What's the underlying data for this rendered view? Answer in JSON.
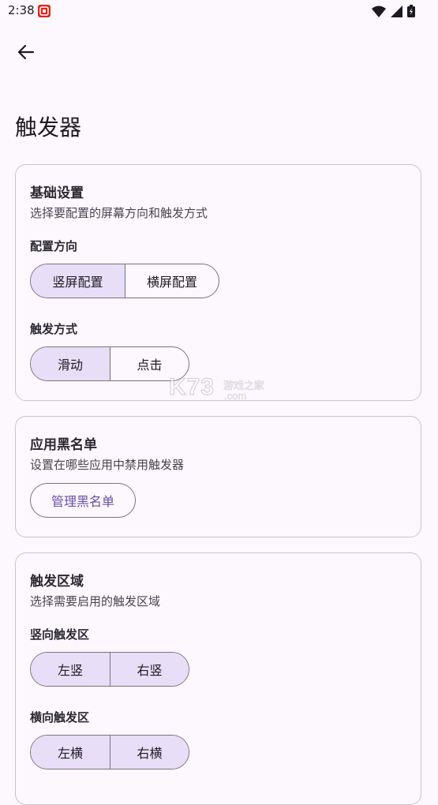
{
  "status_bar": {
    "time": "2:38"
  },
  "page": {
    "title": "触发器"
  },
  "basic_settings": {
    "title": "基础设置",
    "description": "选择要配置的屏幕方向和触发方式",
    "orientation_label": "配置方向",
    "orientation_options": [
      "竖屏配置",
      "横屏配置"
    ],
    "orientation_selected": "竖屏配置",
    "trigger_label": "触发方式",
    "trigger_options": [
      "滑动",
      "点击"
    ],
    "trigger_selected": "滑动"
  },
  "blacklist": {
    "title": "应用黑名单",
    "description": "设置在哪些应用中禁用触发器",
    "manage_button": "管理黑名单"
  },
  "trigger_zones": {
    "title": "触发区域",
    "description": "选择需要启用的触发区域",
    "vertical_label": "竖向触发区",
    "vertical_options": [
      "左竖",
      "右竖"
    ],
    "horizontal_label": "横向触发区",
    "horizontal_options": [
      "左横",
      "右横"
    ]
  },
  "watermark": {
    "brand": "K73",
    "cn": "游戏之家",
    "domain": ".com"
  },
  "colors": {
    "background": "#fdf7fe",
    "selected": "#e8def8",
    "accent": "#6750a4",
    "outline": "#79747e"
  }
}
